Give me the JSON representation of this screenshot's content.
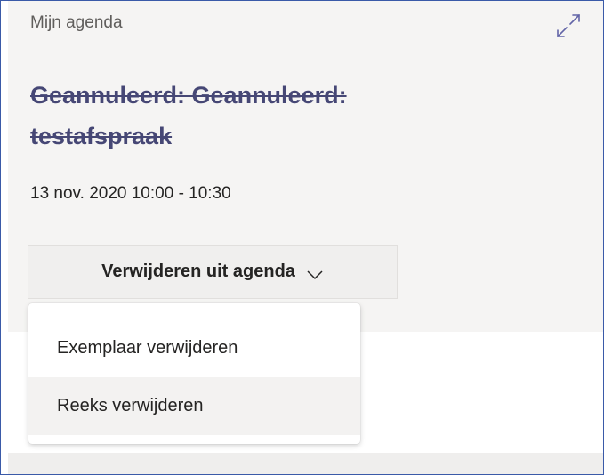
{
  "panel": {
    "header_label": "Mijn agenda",
    "expand_icon": "expand-icon"
  },
  "event": {
    "title": "Geannuleerd: Geannuleerd: testafspraak",
    "datetime": "13 nov. 2020 10:00 - 10:30",
    "title_color": "#464775"
  },
  "actions": {
    "delete_button_label": "Verwijderen uit agenda",
    "dropdown_icon": "chevron-down-icon"
  },
  "menu": {
    "items": [
      {
        "label": "Exemplaar verwijderen"
      },
      {
        "label": "Reeks verwijderen"
      }
    ]
  }
}
